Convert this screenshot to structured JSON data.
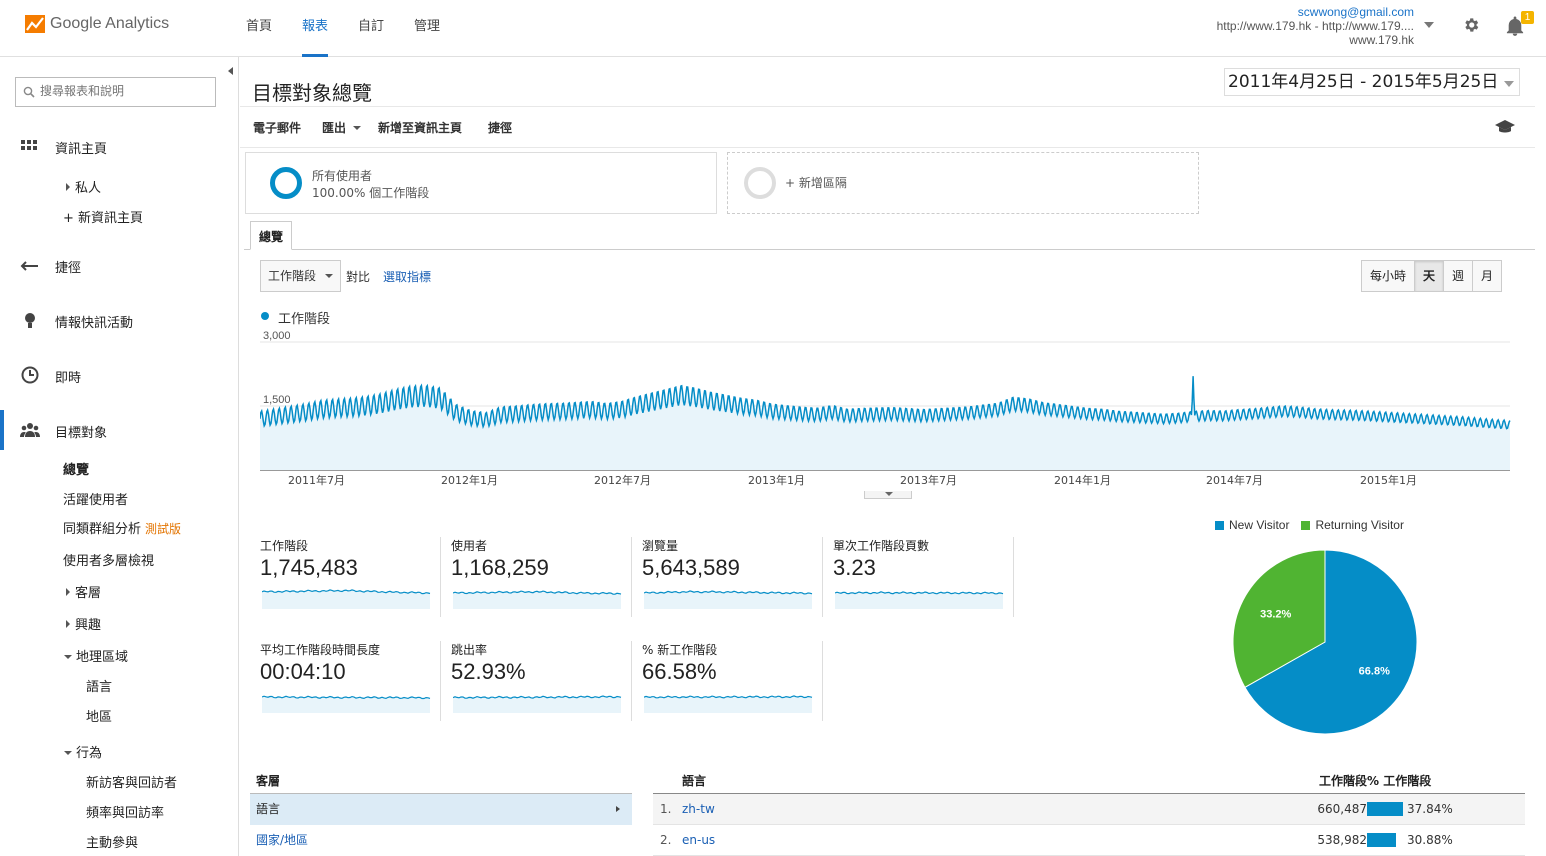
{
  "app": {
    "name": "Google Analytics"
  },
  "nav": {
    "items": [
      "首頁",
      "報表",
      "自訂",
      "管理"
    ],
    "active": 1
  },
  "account": {
    "email": "scwwong@gmail.com",
    "property": "http://www.179.hk - http://www.179....",
    "view": "www.179.hk",
    "notification_count": "1"
  },
  "sidebar": {
    "search_placeholder": "搜尋報表和說明",
    "dashboard": "資訊主頁",
    "private": "私人",
    "new_dashboard": "+ 新資訊主頁",
    "shortcuts": "捷徑",
    "intelligence": "情報快訊活動",
    "realtime": "即時",
    "audience": "目標對象",
    "overview": "總覽",
    "active_users": "活躍使用者",
    "cohort": "同類群組分析",
    "beta": "測試版",
    "user_explorer": "使用者多層檢視",
    "demographics": "客層",
    "interests": "興趣",
    "geo": "地理區域",
    "language": "語言",
    "location": "地區",
    "behavior": "行為",
    "new_vs_returning": "新訪客與回訪者",
    "frequency": "頻率與回訪率",
    "engagement": "主動參與"
  },
  "page": {
    "title": "目標對象總覽",
    "date_range": "2011年4月25日 - 2015年5月25日",
    "toolbar": {
      "email": "電子郵件",
      "export": "匯出",
      "add_dashboard": "新增至資訊主頁",
      "shortcut": "捷徑"
    },
    "segment": {
      "name": "所有使用者",
      "pct": "100.00% 個工作階段",
      "add": "+ 新增區隔"
    },
    "tab": "總覽",
    "metric": "工作階段",
    "vs": "對比",
    "pick_metric": "選取指標",
    "granularity": [
      "每小時",
      "天",
      "週",
      "月"
    ],
    "granularity_selected": 1
  },
  "chart_data": {
    "type": "line",
    "series": [
      {
        "name": "工作階段"
      }
    ],
    "y_ticks": [
      "3,000",
      "1,500"
    ],
    "ylim": [
      0,
      3000
    ],
    "x_ticks": [
      "2011年7月",
      "2012年1月",
      "2012年7月",
      "2013年1月",
      "2013年7月",
      "2014年1月",
      "2014年7月",
      "2015年1月"
    ],
    "values": [
      1200,
      1250,
      1300,
      1350,
      1420,
      1450,
      1470,
      1500,
      1560,
      1650,
      1720,
      1740,
      1680,
      1350,
      1220,
      1180,
      1300,
      1320,
      1350,
      1370,
      1380,
      1400,
      1420,
      1380,
      1420,
      1520,
      1600,
      1680,
      1760,
      1700,
      1620,
      1560,
      1500,
      1460,
      1380,
      1350,
      1320,
      1300,
      1360,
      1280,
      1300,
      1310,
      1320,
      1300,
      1280,
      1300,
      1320,
      1340,
      1380,
      1420,
      1550,
      1520,
      1440,
      1400,
      1360,
      1320,
      1300,
      1260,
      1240,
      1220,
      1200,
      1220,
      1260,
      1280,
      1270,
      1300,
      1320,
      1350,
      1380,
      1360,
      1320,
      1300,
      1290,
      1280,
      1260,
      1240,
      1220,
      1200,
      1180,
      1160,
      1140,
      1110,
      1080,
      1060
    ],
    "spike": {
      "category": "2014年4月",
      "value": 2200
    },
    "colors": {
      "line": "#058dc7",
      "fill": "#e8f4fa"
    }
  },
  "scorecards": [
    {
      "name": "工作階段",
      "value": "1,745,483"
    },
    {
      "name": "使用者",
      "value": "1,168,259"
    },
    {
      "name": "瀏覽量",
      "value": "5,643,589"
    },
    {
      "name": "單次工作階段頁數",
      "value": "3.23"
    },
    {
      "name": "平均工作階段時間長度",
      "value": "00:04:10"
    },
    {
      "name": "跳出率",
      "value": "52.93%"
    },
    {
      "name": "% 新工作階段",
      "value": "66.58%"
    }
  ],
  "pie": {
    "type": "pie",
    "slices": [
      {
        "name": "New Visitor",
        "value": 66.8,
        "label": "66.8%",
        "color": "#058dc7"
      },
      {
        "name": "Returning Visitor",
        "value": 33.2,
        "label": "33.2%",
        "color": "#50b432"
      }
    ]
  },
  "dimension_table": {
    "header": "客層",
    "rows": [
      {
        "label": "語言",
        "selected": true
      },
      {
        "label": "國家/地區",
        "selected": false
      }
    ]
  },
  "data_table": {
    "headers": {
      "dim": "語言",
      "sessions": "工作階段",
      "pct": "% 工作階段"
    },
    "rows": [
      {
        "idx": "1.",
        "lang": "zh-tw",
        "sessions": "660,487",
        "pct": "37.84%",
        "share": 0.3784
      },
      {
        "idx": "2.",
        "lang": "en-us",
        "sessions": "538,982",
        "pct": "30.88%",
        "share": 0.3088
      }
    ]
  }
}
